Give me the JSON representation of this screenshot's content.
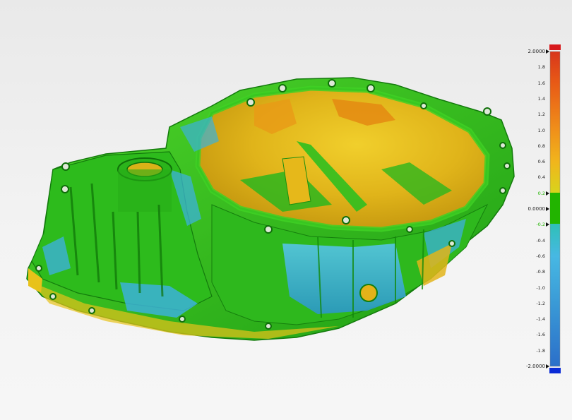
{
  "scale": {
    "max_label": "2.0000",
    "min_label": "-2.0000",
    "zero_label": "0.0000",
    "ticks": [
      "1.8",
      "1.6",
      "1.4",
      "1.2",
      "1.0",
      "0.8",
      "0.6",
      "0.4",
      "0.2",
      "-0.2",
      "-0.4",
      "-0.6",
      "-0.8",
      "-1.0",
      "-1.2",
      "-1.4",
      "-1.6",
      "-1.8"
    ],
    "upper_out_color": "#d7191c",
    "lower_out_color": "#0a2bd6",
    "tolerance_color": "#22b400"
  },
  "part_colors": {
    "nominal": "#2fbf1f",
    "positive": "#e8c21a",
    "high": "#e48a12",
    "negative": "#3cb2d9"
  }
}
